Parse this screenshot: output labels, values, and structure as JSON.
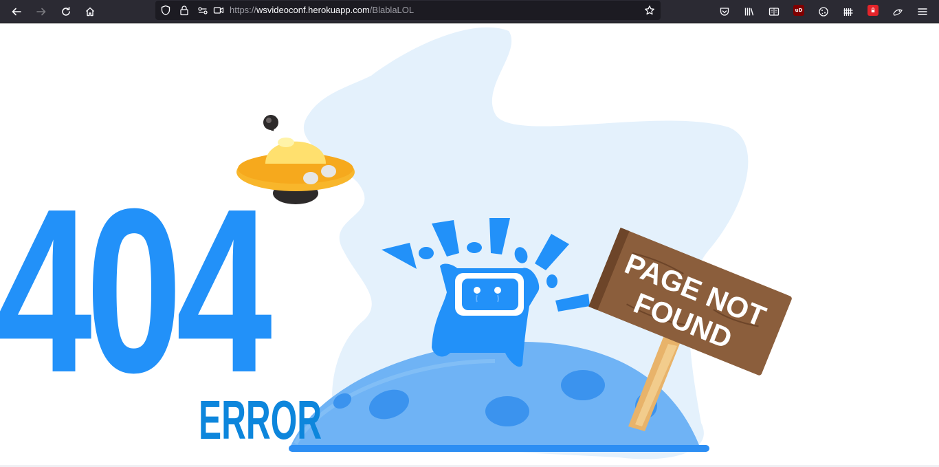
{
  "browser": {
    "nav": {
      "back_icon": "back-arrow-icon",
      "forward_icon": "forward-arrow-icon",
      "reload_icon": "reload-icon",
      "home_icon": "home-icon"
    },
    "url": {
      "scheme": "https://",
      "host": "wsvideoconf.herokuapp.com",
      "path": "/BlablaLOL"
    },
    "toolbar_icons": [
      "pocket-icon",
      "library-icon",
      "reader-view-icon",
      "ublock-icon",
      "cookie-icon",
      "extension-icon",
      "shield-icon",
      "puzzle-icon",
      "menu-icon"
    ],
    "ublock_badge": "uD"
  },
  "page": {
    "code": "404",
    "error_label": "ERROR",
    "sign_line1": "PAGE NOT",
    "sign_line2": "FOUND",
    "colors": {
      "primary_blue": "#2291f9",
      "error_blue": "#0d86dc",
      "blob": "#e4f1fc",
      "moon": "#6fb3f5",
      "sign_wood": "#8b5e3c",
      "ufo_yellow": "#f8b62b"
    }
  }
}
